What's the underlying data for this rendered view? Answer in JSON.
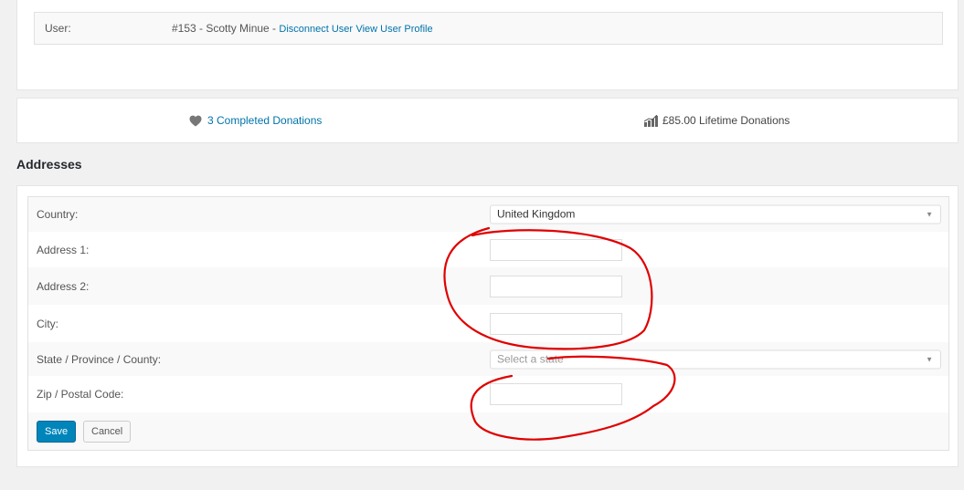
{
  "user": {
    "label": "User:",
    "value": "#153 - Scotty Minue - ",
    "disconnect_link": "Disconnect User",
    "profile_link": "View User Profile"
  },
  "stats": {
    "completed_donations": "3 Completed Donations",
    "lifetime_donations": "£85.00 Lifetime Donations"
  },
  "addresses": {
    "heading": "Addresses",
    "country_label": "Country:",
    "country_value": "United Kingdom",
    "address1_label": "Address 1:",
    "address1_value": "",
    "address2_label": "Address 2:",
    "address2_value": "",
    "city_label": "City:",
    "city_value": "",
    "state_label": "State / Province / County:",
    "state_placeholder": "Select a state",
    "zip_label": "Zip / Postal Code:",
    "zip_value": "",
    "save_label": "Save",
    "cancel_label": "Cancel"
  },
  "icons": {
    "heart": "heart-icon",
    "chart": "chart-icon",
    "dropdown": "chevron-down-icon"
  },
  "colors": {
    "link": "#0073aa",
    "primary_button": "#0085ba",
    "annotation": "#e00000"
  }
}
